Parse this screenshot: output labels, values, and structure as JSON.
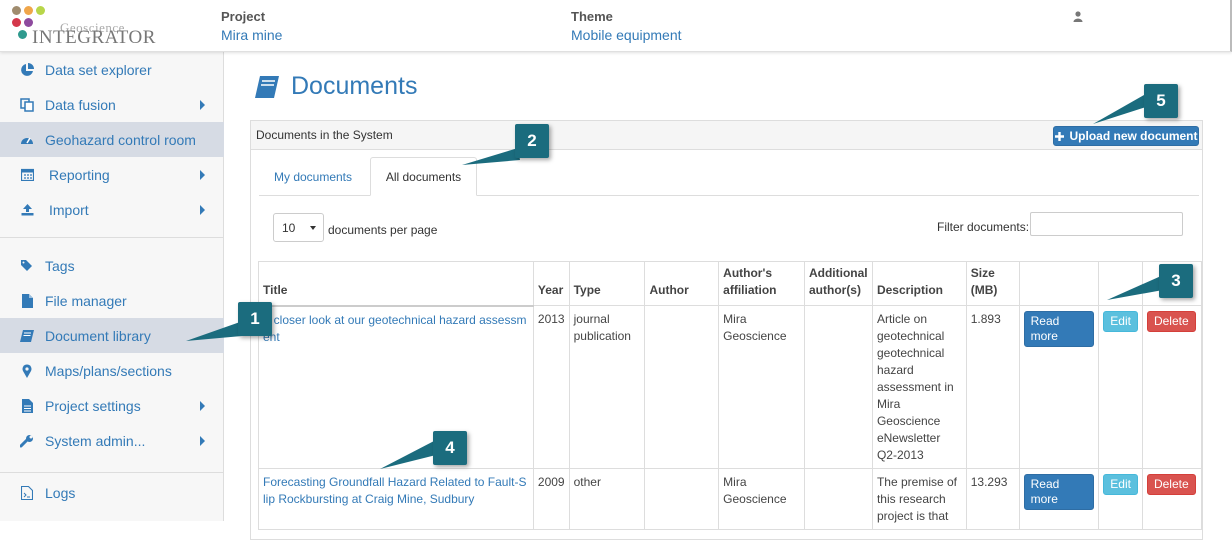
{
  "app": {
    "logo_line1": "Geoscience",
    "logo_line2": "INTEGRATOR"
  },
  "header": {
    "project_label": "Project",
    "project_value": "Mira mine",
    "theme_label": "Theme",
    "theme_value": "Mobile equipment",
    "user_icon": "user-icon"
  },
  "sidebar": {
    "items": [
      {
        "label": "Data set explorer",
        "icon": "pie-chart-icon",
        "submenu": false,
        "active": false
      },
      {
        "label": "Data fusion",
        "icon": "copy-icon",
        "submenu": true,
        "active": false
      },
      {
        "label": "Geohazard control room",
        "icon": "dashboard-icon",
        "submenu": false,
        "active": true
      },
      {
        "label": "Reporting",
        "icon": "calendar-icon",
        "submenu": true,
        "active": false
      },
      {
        "label": "Import",
        "icon": "upload-icon",
        "submenu": true,
        "active": false
      },
      {
        "label": "Tags",
        "icon": "tags-icon",
        "submenu": false,
        "active": false
      },
      {
        "label": "File manager",
        "icon": "file-icon",
        "submenu": false,
        "active": false
      },
      {
        "label": "Document library",
        "icon": "book-icon",
        "submenu": false,
        "active": true
      },
      {
        "label": "Maps/plans/sections",
        "icon": "map-marker-icon",
        "submenu": false,
        "active": false
      },
      {
        "label": "Project settings",
        "icon": "file-text-icon",
        "submenu": true,
        "active": false
      },
      {
        "label": "System admin...",
        "icon": "wrench-icon",
        "submenu": true,
        "active": false
      },
      {
        "label": "Logs",
        "icon": "log-file-icon",
        "submenu": false,
        "active": false
      }
    ]
  },
  "main": {
    "title": "Documents",
    "panel_title": "Documents in the System",
    "upload_button": "Upload new document",
    "tabs": [
      {
        "label": "My documents",
        "active": false
      },
      {
        "label": "All documents",
        "active": true
      }
    ],
    "per_page_value": "10",
    "per_page_label": "documents per page",
    "filter_label": "Filter documents:",
    "filter_value": ""
  },
  "table": {
    "columns": [
      "Title",
      "Year",
      "Type",
      "Author",
      "Author's affiliation",
      "Additional author(s)",
      "Description",
      "Size (MB)",
      "",
      "",
      ""
    ],
    "rows": [
      {
        "title": "A closer look at our geotechnical hazard assessment",
        "year": "2013",
        "type": "journal publication",
        "author": "",
        "affiliation": "Mira Geoscience",
        "additional": "",
        "description": "Article on geotechnical geotechnical hazard assessment in Mira Geoscience eNewsletter Q2-2013",
        "size": "1.893",
        "read_more": "Read more",
        "edit": "Edit",
        "delete": "Delete"
      },
      {
        "title": "Forecasting Groundfall Hazard Related to Fault-Slip Rockbursting at Craig Mine, Sudbury",
        "year": "2009",
        "type": "other",
        "author": "",
        "affiliation": "Mira Geoscience",
        "additional": "",
        "description": "The premise of this research project is that",
        "size": "13.293",
        "read_more": "Read more",
        "edit": "Edit",
        "delete": "Delete"
      }
    ]
  },
  "callouts": [
    "1",
    "2",
    "3",
    "4",
    "5"
  ],
  "colors": {
    "accent": "#337ab7",
    "callout": "#1b6c7e",
    "active_nav": "#d6dbe4",
    "edit": "#5bc0de",
    "delete": "#d9534f"
  }
}
